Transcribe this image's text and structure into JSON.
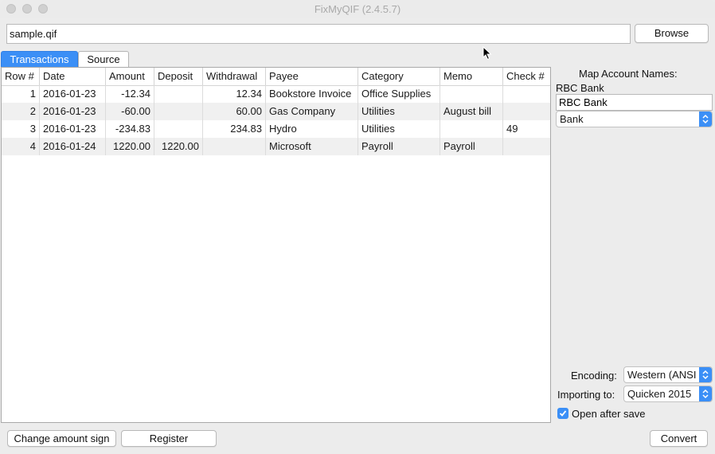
{
  "window": {
    "title": "FixMyQIF (2.4.5.7)"
  },
  "file": {
    "path": "sample.qif",
    "browse_label": "Browse"
  },
  "tabs": [
    {
      "label": "Transactions",
      "active": true
    },
    {
      "label": "Source",
      "active": false
    }
  ],
  "table": {
    "columns": [
      "Row #",
      "Date",
      "Amount",
      "Deposit",
      "Withdrawal",
      "Payee",
      "Category",
      "Memo",
      "Check #"
    ],
    "rows": [
      {
        "row": "1",
        "date": "2016-01-23",
        "amount": "-12.34",
        "deposit": "",
        "withdrawal": "12.34",
        "payee": "Bookstore Invoice",
        "category": "Office Supplies",
        "memo": "",
        "check": ""
      },
      {
        "row": "2",
        "date": "2016-01-23",
        "amount": "-60.00",
        "deposit": "",
        "withdrawal": "60.00",
        "payee": "Gas Company",
        "category": "Utilities",
        "memo": "August bill",
        "check": ""
      },
      {
        "row": "3",
        "date": "2016-01-23",
        "amount": "-234.83",
        "deposit": "",
        "withdrawal": "234.83",
        "payee": "Hydro",
        "category": "Utilities",
        "memo": "",
        "check": "49"
      },
      {
        "row": "4",
        "date": "2016-01-24",
        "amount": "1220.00",
        "deposit": "1220.00",
        "withdrawal": "",
        "payee": "Microsoft",
        "category": "Payroll",
        "memo": "Payroll",
        "check": ""
      }
    ]
  },
  "sidebar": {
    "map_title": "Map Account Names:",
    "account_label": "RBC Bank",
    "account_value": "RBC Bank",
    "account_type": "Bank",
    "encoding_label": "Encoding:",
    "encoding_value": "Western (ANSI",
    "importing_label": "Importing to:",
    "importing_value": "Quicken 2015",
    "open_after_save_label": "Open after save",
    "open_after_save_checked": true
  },
  "footer": {
    "change_sign_label": "Change amount sign",
    "register_label": "Register",
    "convert_label": "Convert"
  },
  "colors": {
    "accent": "#3b8ff6",
    "alt_row": "#f0f0f0"
  }
}
